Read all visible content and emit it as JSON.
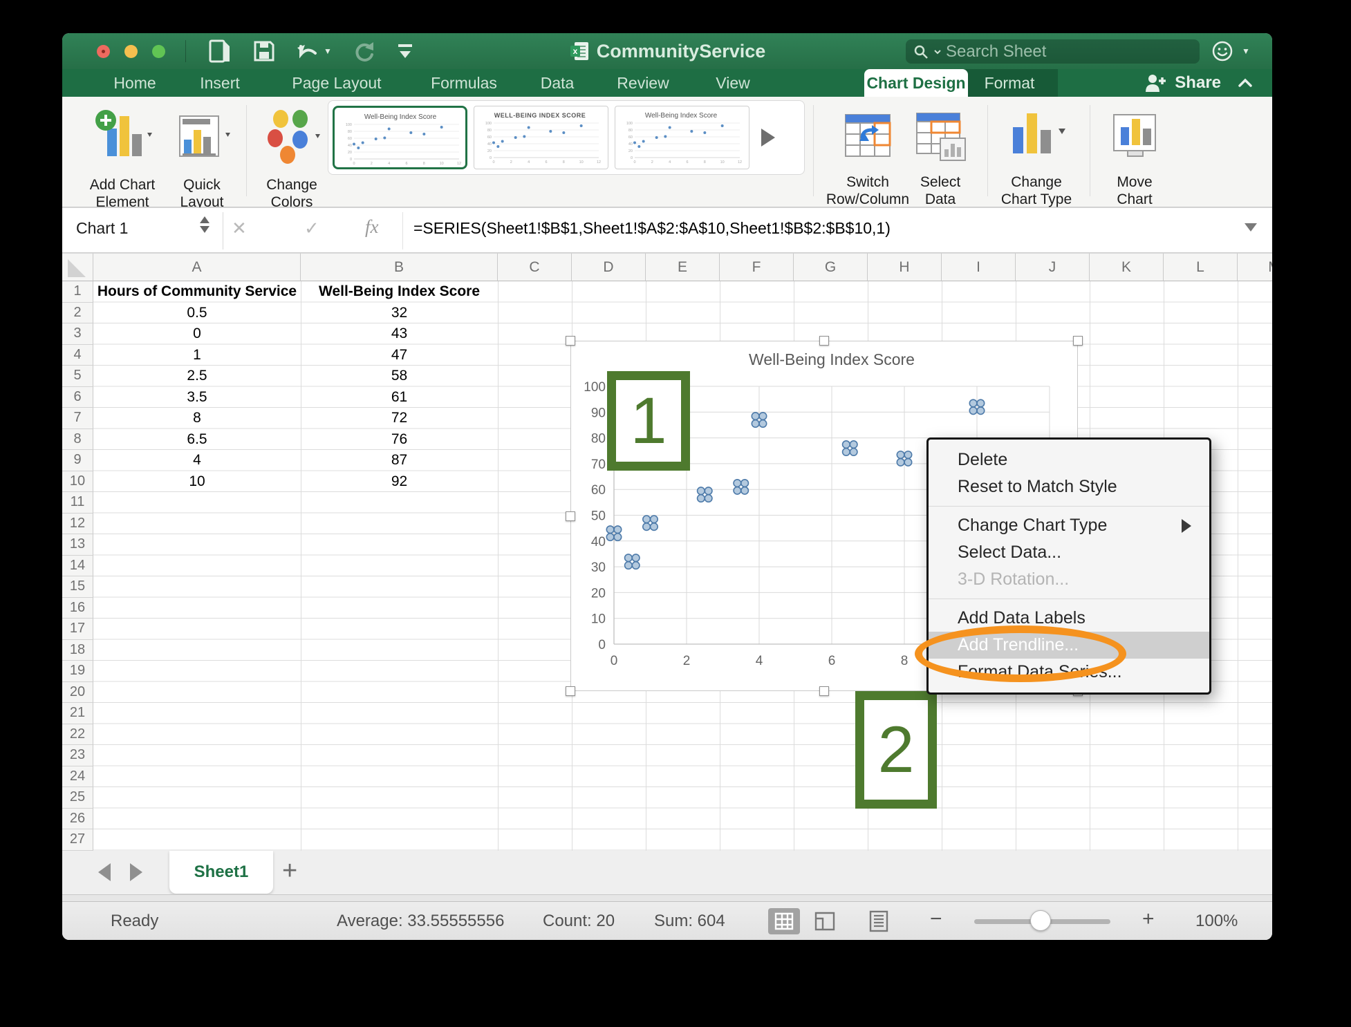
{
  "window": {
    "title": "CommunityService",
    "search_placeholder": "Search Sheet",
    "share_label": "Share"
  },
  "ribbon": {
    "tabs": [
      {
        "label": "Home"
      },
      {
        "label": "Insert"
      },
      {
        "label": "Page Layout"
      },
      {
        "label": "Formulas"
      },
      {
        "label": "Data"
      },
      {
        "label": "Review"
      },
      {
        "label": "View"
      }
    ],
    "active_tab": "Chart Design",
    "contextual_tab": "Format",
    "groups": {
      "add": [
        "Add Chart",
        "Element"
      ],
      "quick": [
        "Quick",
        "Layout"
      ],
      "colors": [
        "Change",
        "Colors"
      ],
      "switch": [
        "Switch",
        "Row/Column"
      ],
      "select": [
        "Select",
        "Data"
      ],
      "change_type": [
        "Change",
        "Chart Type"
      ],
      "move": [
        "Move",
        "Chart"
      ]
    },
    "style_thumbnails": [
      "Well-Being  Index Score",
      "WELL-BEING INDEX SCORE",
      "Well-Being  Index Score"
    ]
  },
  "formula_bar": {
    "name_box": "Chart 1",
    "formula": "=SERIES(Sheet1!$B$1,Sheet1!$A$2:$A$10,Sheet1!$B$2:$B$10,1)"
  },
  "grid": {
    "columns": [
      "A",
      "B",
      "C",
      "D",
      "E",
      "F",
      "G",
      "H",
      "I",
      "J",
      "K",
      "L",
      "M"
    ],
    "row_count": 27,
    "headers": {
      "a": "Hours of Community Service",
      "b": "Well-Being Index Score"
    },
    "rows": [
      [
        "0.5",
        "32"
      ],
      [
        "0",
        "43"
      ],
      [
        "1",
        "47"
      ],
      [
        "2.5",
        "58"
      ],
      [
        "3.5",
        "61"
      ],
      [
        "8",
        "72"
      ],
      [
        "6.5",
        "76"
      ],
      [
        "4",
        "87"
      ],
      [
        "10",
        "92"
      ]
    ]
  },
  "chart_data": {
    "type": "scatter",
    "title": "Well-Being Index Score",
    "points": [
      {
        "x": 0.5,
        "y": 32
      },
      {
        "x": 0,
        "y": 43
      },
      {
        "x": 1,
        "y": 47
      },
      {
        "x": 2.5,
        "y": 58
      },
      {
        "x": 3.5,
        "y": 61
      },
      {
        "x": 8,
        "y": 72
      },
      {
        "x": 6.5,
        "y": 76
      },
      {
        "x": 4,
        "y": 87
      },
      {
        "x": 10,
        "y": 92
      }
    ],
    "xlabel": "",
    "ylabel": "",
    "xlim": [
      0,
      12
    ],
    "x_ticks": [
      0,
      2,
      4,
      6,
      8,
      10,
      12
    ],
    "ylim": [
      0,
      100
    ],
    "y_tick_step": 10,
    "grid": true,
    "legend": "none",
    "title_color": "#595959",
    "tick_color": "#666666",
    "gridline_color": "#d9d9d9",
    "axis_color": "#bfbfbf",
    "marker_fill": "#b3c9de",
    "marker_stroke": "#4d7aa9"
  },
  "context_menu": {
    "items": [
      {
        "label": "Delete"
      },
      {
        "label": "Reset to Match Style"
      },
      {
        "type": "separator"
      },
      {
        "label": "Change Chart Type",
        "submenu": true
      },
      {
        "label": "Select Data..."
      },
      {
        "label": "3-D Rotation...",
        "disabled": true
      },
      {
        "type": "separator"
      },
      {
        "label": "Add Data Labels"
      },
      {
        "label": "Add Trendline...",
        "highlighted": true
      },
      {
        "label": "Format Data Series..."
      }
    ]
  },
  "annotations": {
    "step1": "1",
    "step2": "2",
    "green": "#4e7a2e",
    "orange": "#f5921e"
  },
  "sheet_tabs": {
    "active": "Sheet1",
    "add_label": "+"
  },
  "status_bar": {
    "ready": "Ready",
    "average": "Average: 33.55555556",
    "count": "Count: 20",
    "sum": "Sum: 604",
    "zoom_level": "100%"
  }
}
